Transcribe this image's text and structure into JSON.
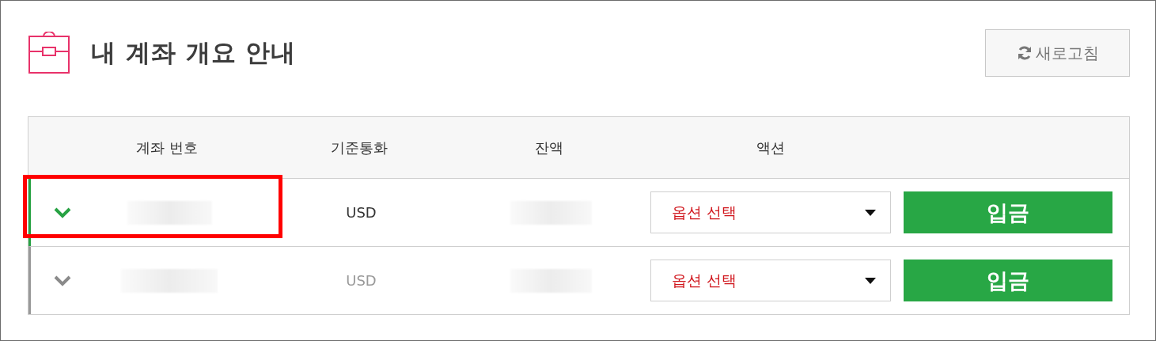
{
  "header": {
    "title": "내 계좌 개요 안내",
    "refresh_button": "새로고침"
  },
  "table": {
    "columns": [
      "계좌 번호",
      "기준통화",
      "잔액",
      "액션"
    ],
    "rows": [
      {
        "selected": true,
        "highlighted": true,
        "currency": "USD",
        "action_select": "옵션 선택",
        "deposit_button": "입금"
      },
      {
        "selected": false,
        "highlighted": false,
        "currency": "USD",
        "action_select": "옵션 선택",
        "deposit_button": "입금"
      }
    ]
  }
}
